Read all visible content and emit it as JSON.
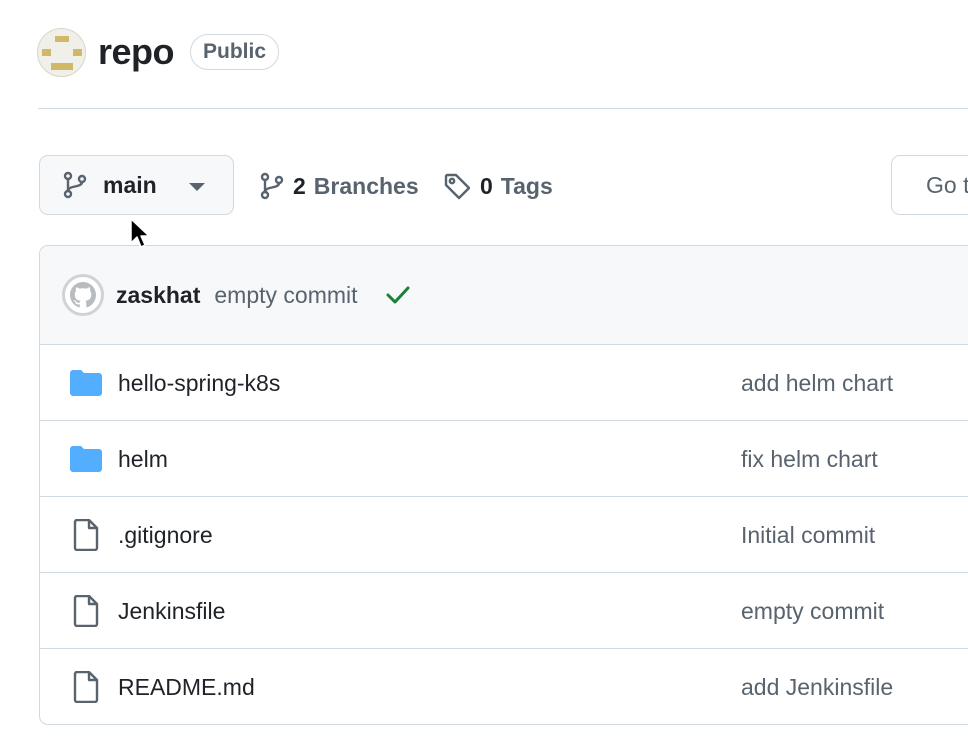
{
  "repo": {
    "name": "repo",
    "visibility": "Public"
  },
  "toolbar": {
    "branch": "main",
    "branches_count": "2",
    "branches_label": "Branches",
    "tags_count": "0",
    "tags_label": "Tags",
    "search_placeholder": "Go to file"
  },
  "latest_commit": {
    "author": "zaskhat",
    "message": "empty commit",
    "status": "success",
    "status_color": "#1a7f37"
  },
  "files": [
    {
      "name": "hello-spring-k8s",
      "type": "folder",
      "commit": "add helm chart"
    },
    {
      "name": "helm",
      "type": "folder",
      "commit": "fix helm chart"
    },
    {
      "name": ".gitignore",
      "type": "file",
      "commit": "Initial commit"
    },
    {
      "name": "Jenkinsfile",
      "type": "file",
      "commit": "empty commit"
    },
    {
      "name": "README.md",
      "type": "file",
      "commit": "add Jenkinsfile"
    }
  ],
  "colors": {
    "folder": "#54aeff",
    "border": "#d1d9e0",
    "muted_text": "#59636e"
  }
}
